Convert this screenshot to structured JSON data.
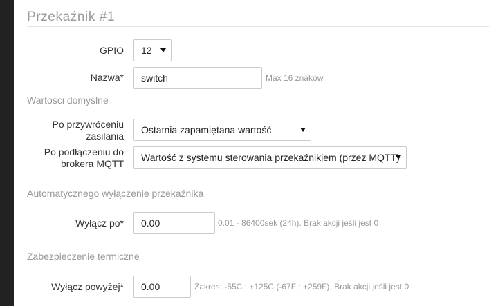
{
  "page": {
    "title": "Przekaźnik #1"
  },
  "gpio": {
    "label": "GPIO",
    "value": "12"
  },
  "name": {
    "label": "Nazwa*",
    "value": "switch",
    "hint": "Max 16 znaków"
  },
  "defaults": {
    "heading": "Wartości domyślne",
    "power_restore": {
      "label_line1": "Po przywróceniu",
      "label_line2": "zasilania",
      "value": "Ostatnia zapamiętana wartość"
    },
    "mqtt_connect": {
      "label_line1": "Po podłączeniu do",
      "label_line2": "brokera MQTT",
      "value": "Wartość z systemu sterowania przekaźnikiem (przez MQTT)"
    }
  },
  "auto_off": {
    "heading": "Automatycznego wyłączenie przekaźnika",
    "label": "Wyłącz po*",
    "value": "0.00",
    "hint": "0.01 - 86400sek (24h). Brak akcji jeśli jest 0"
  },
  "thermal": {
    "heading": "Zabezpieczenie termiczne",
    "label": "Wyłącz powyżej*",
    "value": "0.00",
    "hint": "Zakres: -55C : +125C (-67F : +259F). Brak akcji jeśli jest 0"
  },
  "icons": {
    "dropdown": "caret-down-icon"
  },
  "colors": {
    "sidebar": "#222222",
    "muted_text": "#999999",
    "border": "#cccccc"
  }
}
